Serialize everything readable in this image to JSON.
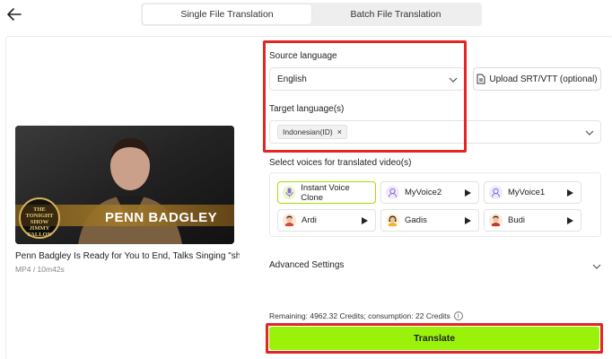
{
  "header": {
    "back_icon": "arrow-left-icon",
    "tabs": [
      {
        "label": "Single File Translation",
        "active": true
      },
      {
        "label": "Batch File Translation",
        "active": false
      }
    ]
  },
  "video": {
    "thumbnail_text": "PENN BADGLEY",
    "show_logo_lines": [
      "THE",
      "TONIGHT",
      "SHOW",
      "JIMMY",
      "FALLON"
    ],
    "title": "Penn Badgley Is Ready for You to End, Talks Singing \"shu...",
    "meta": "MP4 / 10m42s"
  },
  "source": {
    "label": "Source language",
    "value": "English"
  },
  "upload": {
    "label": "Upload SRT/VTT (optional)",
    "icon": "document-icon"
  },
  "target": {
    "label": "Target language(s)",
    "chips": [
      "Indonesian(ID)"
    ],
    "chip_remove": "×"
  },
  "voices": {
    "label": "Select voices for translated video(s)",
    "items": [
      {
        "name": "Instant Voice Clone",
        "icon": "mic-icon",
        "selected": true
      },
      {
        "name": "MyVoice2",
        "icon": "voice-avatar-icon",
        "selected": false
      },
      {
        "name": "MyVoice1",
        "icon": "voice-avatar-icon",
        "selected": false
      },
      {
        "name": "Ardi",
        "icon": "male-avatar-icon",
        "selected": false
      },
      {
        "name": "Gadis",
        "icon": "female-avatar-icon",
        "selected": false
      },
      {
        "name": "Budi",
        "icon": "male-avatar-icon",
        "selected": false
      }
    ]
  },
  "advanced": {
    "label": "Advanced Settings"
  },
  "credits": {
    "text": "Remaining: 4962.32 Credits; consumption: 22 Credits",
    "info": "i"
  },
  "translate": {
    "label": "Translate"
  },
  "colors": {
    "accent": "#9af20a",
    "highlight": "#e52424",
    "selected_border": "#9fe000"
  }
}
